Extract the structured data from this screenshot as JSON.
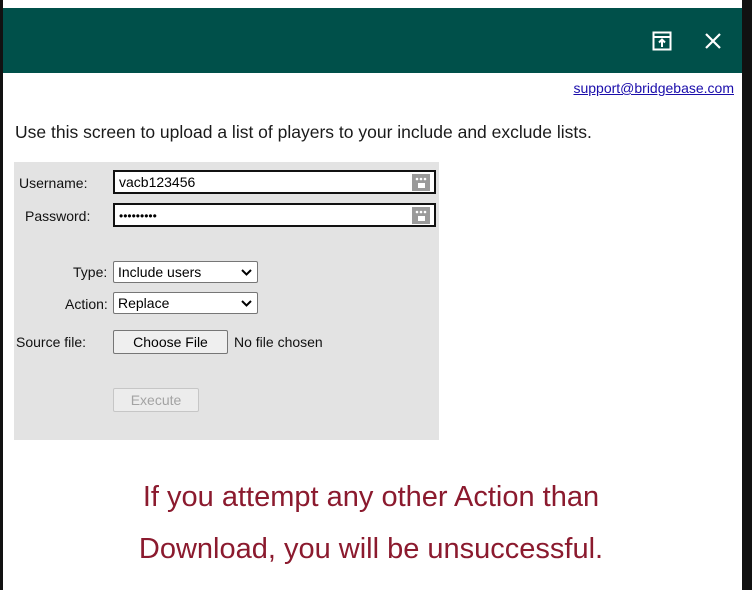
{
  "window": {
    "popout_label": "Pop out",
    "close_label": "Close"
  },
  "header": {
    "support_link": "support@bridgebase.com"
  },
  "intro_text": "Use this screen to upload a list of players to your include and exclude lists.",
  "form": {
    "username_label": "Username:",
    "username_value": "vacb123456",
    "password_label": "Password:",
    "password_value": "•••••••••",
    "type_label": "Type:",
    "type_value": "Include users",
    "action_label": "Action:",
    "action_value": "Replace",
    "source_label": "Source file:",
    "choose_file_label": "Choose File",
    "file_status": "No file chosen",
    "execute_label": "Execute"
  },
  "warning": {
    "line1": "If you attempt any other Action than",
    "line2": "Download, you will be unsuccessful."
  },
  "colors": {
    "titlebar": "#00504a",
    "panel": "#e3e3e3",
    "warning_text": "#8b1a2e",
    "link": "#1a0dab"
  }
}
